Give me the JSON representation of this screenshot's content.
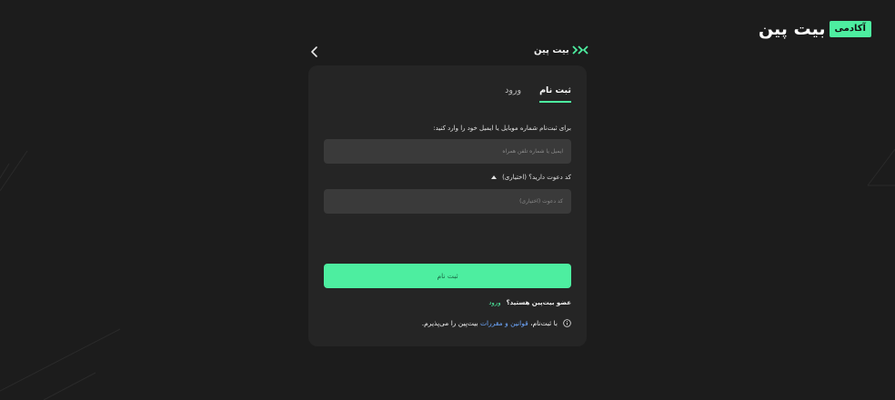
{
  "academy_logo": {
    "badge": "آکادمی",
    "brand": "بیت پین"
  },
  "header": {
    "brand": "بیت پین",
    "icons": [
      "chevron-left-icon",
      "bitpin-logo-icon"
    ]
  },
  "tabs": [
    {
      "label": "ورود",
      "active": false
    },
    {
      "label": "ثبت نام",
      "active": true
    }
  ],
  "form": {
    "identifier_label": "برای ثبت‌نام شماره موبایل یا ایمیل خود را وارد کنید:",
    "identifier_placeholder": "ایمیل یا شماره تلفن همراه",
    "invite_label": "کد دعوت دارید؟ (اختیاری)",
    "invite_placeholder": "کد دعوت (اختیاری)",
    "submit_label": "ثبت نام",
    "member_question": "عضو بیت‌پین هستید؟",
    "login_link": "ورود",
    "terms_prefix": "با ثبت‌نام،",
    "terms_link": "قوانین و مقررات",
    "terms_suffix": "بیت‌پین را می‌پذیرم."
  },
  "colors": {
    "background": "#1c1c1c",
    "card": "#252525",
    "input": "#3a3a3a",
    "accent": "#4deea0",
    "link": "#6ea8ff"
  }
}
